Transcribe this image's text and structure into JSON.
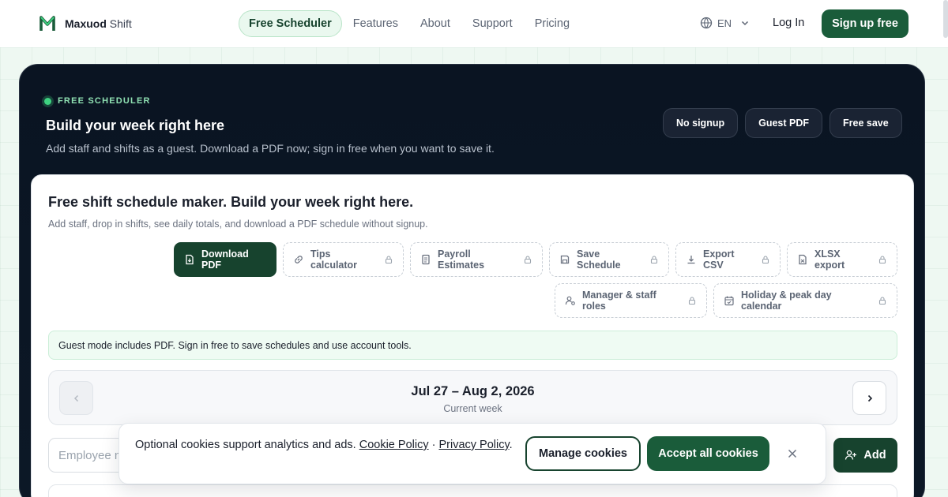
{
  "brand": {
    "name_bold": "Maxuod",
    "name_light": "Shift"
  },
  "nav": {
    "links": [
      {
        "label": "Free Scheduler",
        "active": true
      },
      {
        "label": "Features"
      },
      {
        "label": "About"
      },
      {
        "label": "Support"
      },
      {
        "label": "Pricing"
      }
    ],
    "lang": "EN",
    "login": "Log In",
    "signup": "Sign up free"
  },
  "hero": {
    "tag": "FREE SCHEDULER",
    "title": "Build your week right here",
    "subtitle": "Add staff and shifts as a guest. Download a PDF now; sign in free when you want to save it.",
    "pills": [
      "No signup",
      "Guest PDF",
      "Free save"
    ]
  },
  "card": {
    "title": "Free shift schedule maker. Build your week right here.",
    "subtitle": "Add staff, drop in shifts, see daily totals, and download a PDF schedule without signup.",
    "tools": {
      "download_pdf": "Download PDF",
      "tips": "Tips calculator",
      "payroll": "Payroll Estimates",
      "save": "Save Schedule",
      "csv": "Export CSV",
      "xlsx": "XLSX export",
      "manager": "Manager & staff roles",
      "holiday": "Holiday & peak day calendar"
    },
    "guest_note": "Guest mode includes PDF. Sign in free to save schedules and use account tools.",
    "week": {
      "range": "Jul 27 – Aug 2, 2026",
      "label": "Current week"
    },
    "employee_placeholder": "Employee name",
    "add": "Add"
  },
  "cookie": {
    "text": "Optional cookies support analytics and ads.",
    "cookie_policy": "Cookie Policy",
    "separator": "·",
    "privacy_policy": "Privacy Policy",
    "period": ".",
    "manage": "Manage cookies",
    "accept": "Accept all cookies"
  },
  "colors": {
    "brand_green": "#1a5c3a",
    "dark_green": "#17432e",
    "hero_bg": "#0a1422",
    "accent_mint": "#3ed281"
  }
}
